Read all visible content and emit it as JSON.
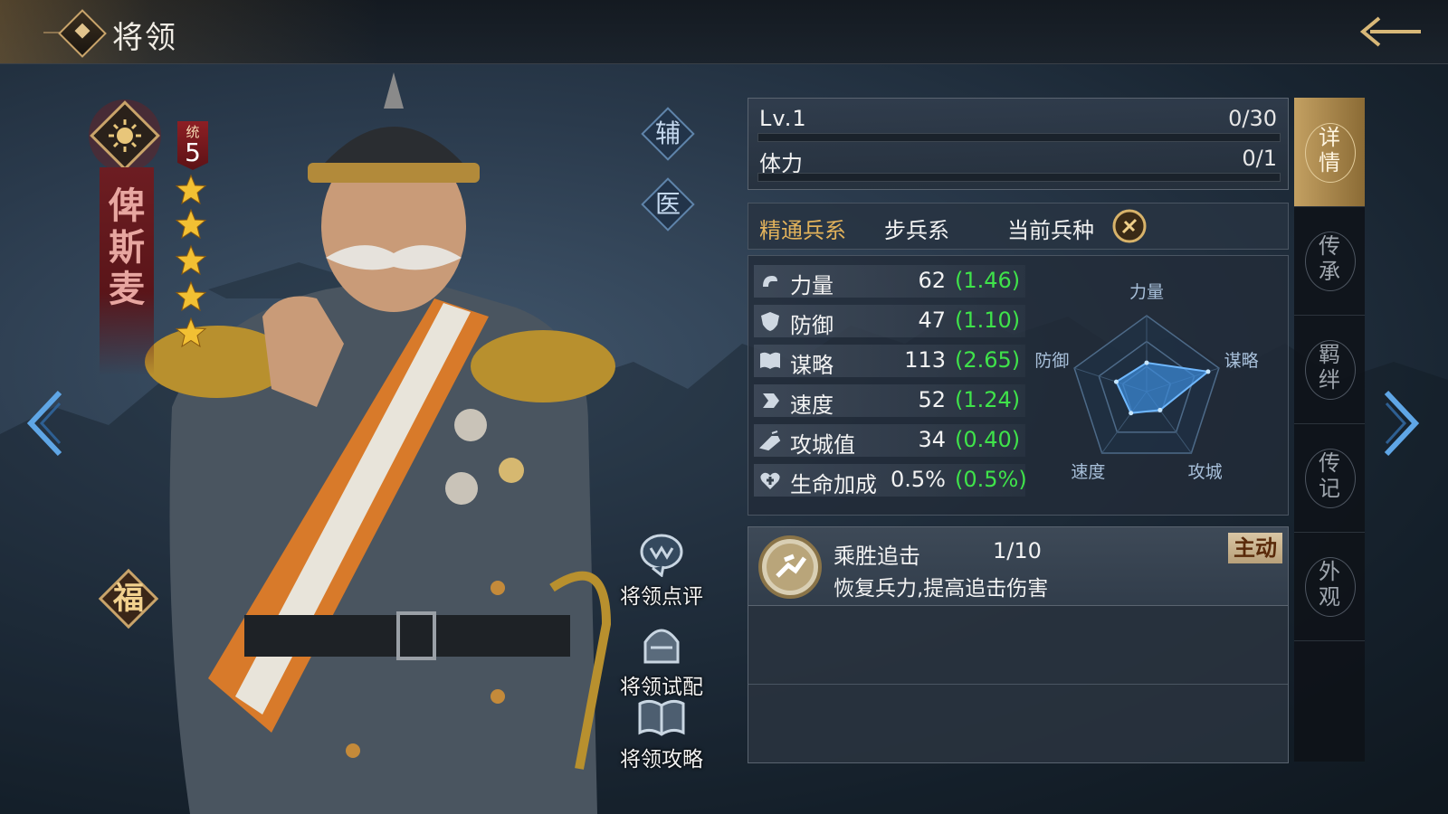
{
  "header": {
    "title": "将领"
  },
  "hero": {
    "name": "俾斯麦",
    "rank_label": "统",
    "rank_value": "5",
    "stars": 5,
    "badge": "福"
  },
  "roles": {
    "support": "辅",
    "medic": "医"
  },
  "actions": [
    {
      "label": "将领点评",
      "icon": "comment-icon"
    },
    {
      "label": "将领试配",
      "icon": "helmet-icon"
    },
    {
      "label": "将领攻略",
      "icon": "book-icon"
    }
  ],
  "level": {
    "label": "Lv.1",
    "value": "0/30"
  },
  "stamina": {
    "label": "体力",
    "value": "0/1"
  },
  "troop": {
    "key": "精通兵系",
    "value": "步兵系",
    "current_label": "当前兵种"
  },
  "stats": [
    {
      "name": "力量",
      "value": "62",
      "growth": "(1.46)",
      "icon": "strength-icon"
    },
    {
      "name": "防御",
      "value": "47",
      "growth": "(1.10)",
      "icon": "shield-icon"
    },
    {
      "name": "谋略",
      "value": "113",
      "growth": "(2.65)",
      "icon": "book-icon"
    },
    {
      "name": "速度",
      "value": "52",
      "growth": "(1.24)",
      "icon": "speed-icon"
    },
    {
      "name": "攻城值",
      "value": "34",
      "growth": "(0.40)",
      "icon": "siege-icon"
    },
    {
      "name": "生命加成",
      "value": "0.5%",
      "growth": "(0.5%)",
      "icon": "health-icon"
    }
  ],
  "radar": {
    "labels": [
      "力量",
      "谋略",
      "攻城",
      "速度",
      "防御"
    ],
    "values": [
      0.38,
      0.85,
      0.3,
      0.35,
      0.42
    ]
  },
  "skill": {
    "name": "乘胜追击",
    "level": "1/10",
    "desc": "恢复兵力,提高追击伤害",
    "tag": "主动"
  },
  "tabs": [
    {
      "label": "详情",
      "active": true
    },
    {
      "label": "传承",
      "active": false
    },
    {
      "label": "羁绊",
      "active": false
    },
    {
      "label": "传记",
      "active": false
    },
    {
      "label": "外观",
      "active": false
    }
  ],
  "colors": {
    "gold": "#e2b25b",
    "growth": "#3fe34a",
    "banner": "#6d1d22",
    "accent": "#c3a062"
  }
}
